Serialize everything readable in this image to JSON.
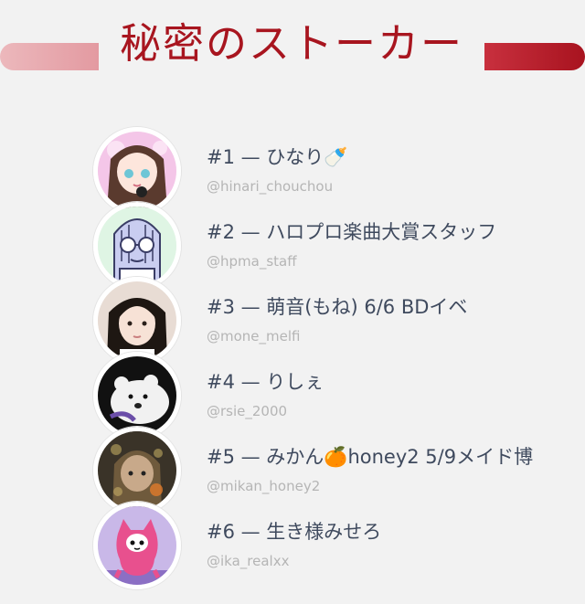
{
  "header": {
    "title": "秘密のストーカー"
  },
  "stalkers": [
    {
      "name": "#1 — ひなり🍼",
      "handle": "@hinari_chouchou",
      "avatar": "avatar-anime-girl-pink"
    },
    {
      "name": "#2 — ハロプロ楽曲大賞スタッフ",
      "handle": "@hpma_staff",
      "avatar": "avatar-doodle-glasses"
    },
    {
      "name": "#3 — 萌音(もね) 6/6 BDイベ",
      "handle": "@mone_melfi",
      "avatar": "avatar-photo-girl"
    },
    {
      "name": "#4 — りしぇ",
      "handle": "@rsie_2000",
      "avatar": "avatar-polar-bear-plush"
    },
    {
      "name": "#5 — みかん🍊honey2 5/9メイド博",
      "handle": "@mikan_honey2",
      "avatar": "avatar-dark-illustration"
    },
    {
      "name": "#6 — 生き様みせろ",
      "handle": "@ika_realxx",
      "avatar": "avatar-pink-cat-character"
    }
  ],
  "colors": {
    "accent": "#a8151f",
    "name_text": "#3f4a5e",
    "handle_text": "#b5b5b5",
    "background": "#f2f2f2"
  }
}
